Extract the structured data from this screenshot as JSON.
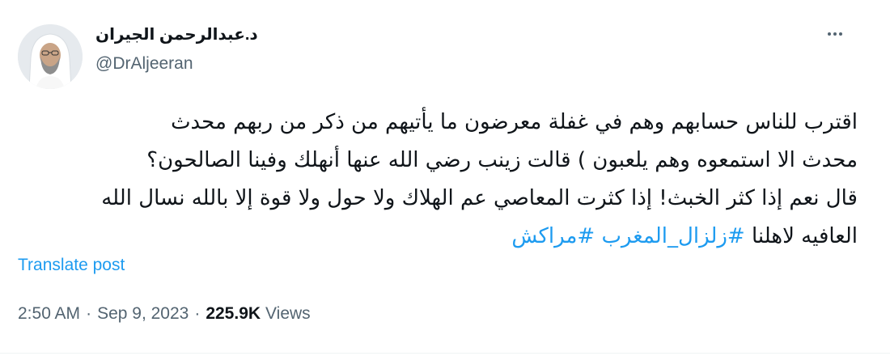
{
  "author": {
    "name": "د.عبدالرحمن الجيران",
    "handle": "@DrAljeeran"
  },
  "post": {
    "text_lines": [
      "اقترب للناس حسابهم وهم في غفلة معرضون ما يأتيهم من ذكر من ربهم محدث",
      "محدث الا استمعوه وهم يلعبون ) قالت زينب رضي الله عنها  أنهلك وفينا الصالحون؟",
      "قال نعم إذا كثر الخبث! إذا كثرت المعاصي عم الهلاك ولا حول ولا قوة إلا بالله نسال الله",
      "العافيه لاهلنا"
    ],
    "hashtags": [
      "#زلزال_المغرب",
      "#مراكش"
    ],
    "translate_label": "Translate post"
  },
  "meta": {
    "time": "2:50 AM",
    "separator": "·",
    "date": "Sep 9, 2023",
    "views_count": "225.9K",
    "views_label": "Views"
  },
  "icons": {
    "more": "more-horizontal-icon",
    "avatar": "profile-avatar"
  },
  "colors": {
    "accent": "#1d9bf0",
    "text": "#0f1419",
    "muted": "#536471"
  }
}
